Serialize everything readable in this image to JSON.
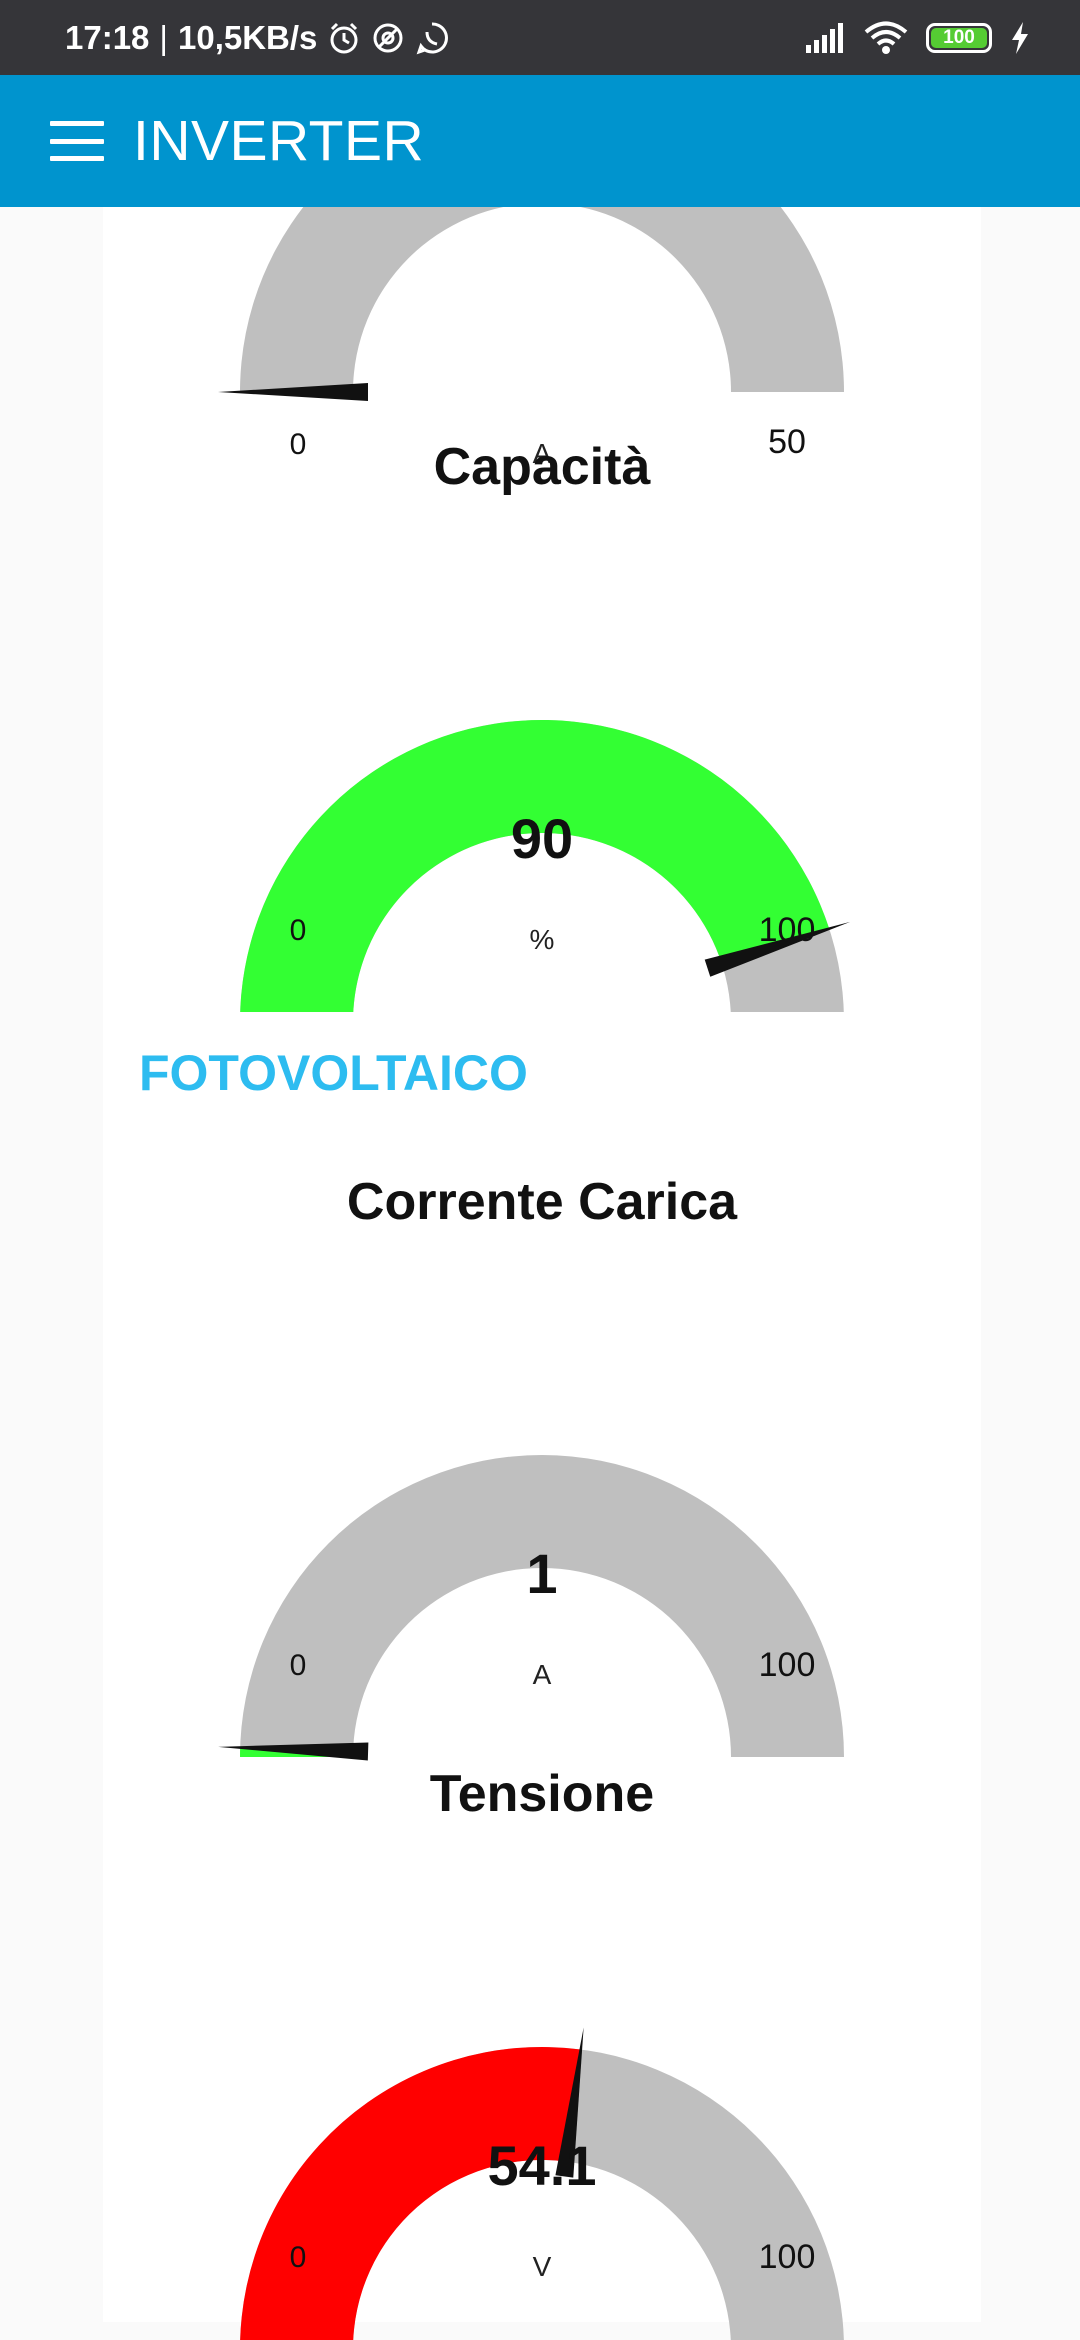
{
  "status_bar": {
    "time": "17:18",
    "separator": "|",
    "speed": "10,5KB/s",
    "battery": "100",
    "icons": [
      "alarm-icon",
      "data-saver-icon",
      "whatsapp-icon",
      "signal-icon",
      "wifi-icon",
      "battery-icon",
      "charging-icon"
    ]
  },
  "app_bar": {
    "title": "INVERTER",
    "menu_icon": "hamburger-menu-icon",
    "color": "#0094ce"
  },
  "colors": {
    "track": "#bfbfbf",
    "green": "#33ff33",
    "red": "#ff0000",
    "group_title": "#2dbcf0"
  },
  "groups": [
    {
      "title": "",
      "gauges": [
        {
          "title": "",
          "value": 0,
          "value_label": "",
          "units": "A",
          "min": 0,
          "max": 50,
          "min_label": "0",
          "max_label": "50",
          "color": "#33ff33"
        },
        {
          "title": "Capacità",
          "value": 90,
          "value_label": "90",
          "units": "%",
          "min": 0,
          "max": 100,
          "min_label": "0",
          "max_label": "100",
          "color": "#33ff33"
        }
      ]
    },
    {
      "title": "FOTOVOLTAICO",
      "gauges": [
        {
          "title": "Corrente Carica",
          "value": 1,
          "value_label": "1",
          "units": "A",
          "min": 0,
          "max": 100,
          "min_label": "0",
          "max_label": "100",
          "color": "#33ff33"
        },
        {
          "title": "Tensione",
          "value": 54.1,
          "value_label": "54.1",
          "units": "V",
          "min": 0,
          "max": 100,
          "min_label": "0",
          "max_label": "100",
          "color": "#ff0000"
        }
      ]
    }
  ]
}
